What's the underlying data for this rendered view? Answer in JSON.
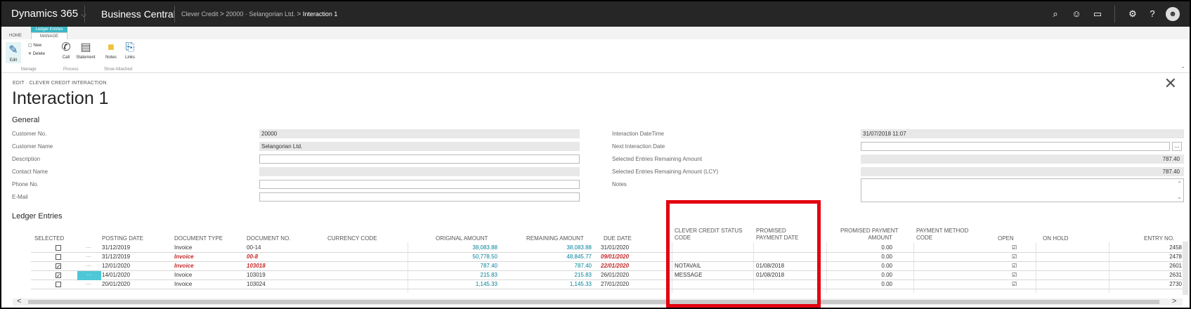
{
  "topbar": {
    "app_name": "Dynamics 365",
    "app_chevron": "⌵",
    "product": "Business Central",
    "breadcrumb": [
      "Clever Credit",
      "20000 · Selangorian Ltd.",
      "Interaction 1"
    ],
    "crumb_sep": ">"
  },
  "ribbon": {
    "context_label": "Ledger Entries",
    "tabs": [
      "HOME",
      "MANAGE"
    ],
    "buttons": {
      "edit": "Edit",
      "new": "New",
      "delete": "Delete",
      "call": "Call",
      "statement": "Statement",
      "notes": "Notes",
      "links": "Links"
    },
    "groups": {
      "manage": "Manage",
      "process": "Process",
      "show_attached": "Show Attached"
    }
  },
  "page": {
    "mode": "EDIT · CLEVER CREDIT INTERACTION",
    "title": "Interaction 1",
    "general_section": "General",
    "ledger_section": "Ledger Entries"
  },
  "general": {
    "customer_no_label": "Customer No.",
    "customer_no": "20000",
    "customer_name_label": "Customer Name",
    "customer_name": "Selangorian Ltd.",
    "description_label": "Description",
    "description": "",
    "contact_name_label": "Contact Name",
    "contact_name": "",
    "phone_label": "Phone No.",
    "phone": "",
    "email_label": "E-Mail",
    "email": "",
    "interaction_dt_label": "Interaction DateTime",
    "interaction_dt": "31/07/2018 11:07",
    "next_date_label": "Next Interaction Date",
    "next_date": "",
    "sel_rem_label": "Selected Entries Remaining Amount",
    "sel_rem": "787.40",
    "sel_rem_lcy_label": "Selected Entries Remaining Amount (LCY)",
    "sel_rem_lcy": "787.40",
    "notes_label": "Notes",
    "lookup": "..."
  },
  "ledger": {
    "headers": {
      "selected": "SELECTED",
      "posting_date": "POSTING DATE",
      "doc_type": "DOCUMENT TYPE",
      "doc_no": "DOCUMENT NO.",
      "currency": "CURRENCY CODE",
      "orig": "ORIGINAL AMOUNT",
      "remaining": "REMAINING AMOUNT",
      "due": "DUE DATE",
      "ccs1": "CLEVER CREDIT STATUS",
      "ccs2": "CODE",
      "ppd1": "PROMISED",
      "ppd2": "PAYMENT DATE",
      "ppa1": "PROMISED PAYMENT",
      "ppa2": "AMOUNT",
      "pmc1": "PAYMENT METHOD",
      "pmc2": "CODE",
      "open": "OPEN",
      "on_hold": "ON HOLD",
      "entry_no": "ENTRY NO."
    },
    "rows": [
      {
        "selected": "",
        "dots": "···",
        "posting": "31/12/2019",
        "type": "Invoice",
        "doc": "00-14",
        "orig": "38,083.88",
        "rem": "38,083.88",
        "due": "31/01/2020",
        "status": "",
        "pdate": "",
        "pamt": "0.00",
        "open": "☑",
        "entry": "2458",
        "red": false
      },
      {
        "selected": "",
        "dots": "···",
        "posting": "31/12/2019",
        "type": "Invoice",
        "doc": "00-8",
        "orig": "50,778.50",
        "rem": "48,845.77",
        "due": "09/01/2020",
        "status": "",
        "pdate": "",
        "pamt": "0.00",
        "open": "☑",
        "entry": "2478",
        "red": true
      },
      {
        "selected": "✓",
        "dots": "···",
        "posting": "12/01/2020",
        "type": "Invoice",
        "doc": "103018",
        "orig": "787.40",
        "rem": "787.40",
        "due": "22/01/2020",
        "status": "NOTAVAIL",
        "pdate": "01/08/2018",
        "pamt": "0.00",
        "open": "☑",
        "entry": "2601",
        "red": true
      },
      {
        "selected": "✓",
        "dots": "···",
        "posting": "14/01/2020",
        "type": "Invoice",
        "doc": "103019",
        "orig": "215.83",
        "rem": "215.83",
        "due": "26/01/2020",
        "status": "MESSAGE",
        "pdate": "01/08/2018",
        "pamt": "0.00",
        "open": "☑",
        "entry": "2631",
        "red": false
      },
      {
        "selected": "",
        "dots": "···",
        "posting": "20/01/2020",
        "type": "Invoice",
        "doc": "103024",
        "orig": "1,145.33",
        "rem": "1,145.33",
        "due": "27/01/2020",
        "status": "",
        "pdate": "",
        "pamt": "0.00",
        "open": "☑",
        "entry": "2730",
        "red": false
      }
    ],
    "scroll_left": "<",
    "scroll_right": ">"
  },
  "colors": {
    "topbar": "#262626",
    "accent": "#3ab7c6",
    "link": "#00829b",
    "highlight": "#e3000f"
  },
  "icons": [
    "search-icon",
    "smiley-icon",
    "chat-icon",
    "gear-icon",
    "help-icon",
    "user-icon",
    "close-icon"
  ]
}
